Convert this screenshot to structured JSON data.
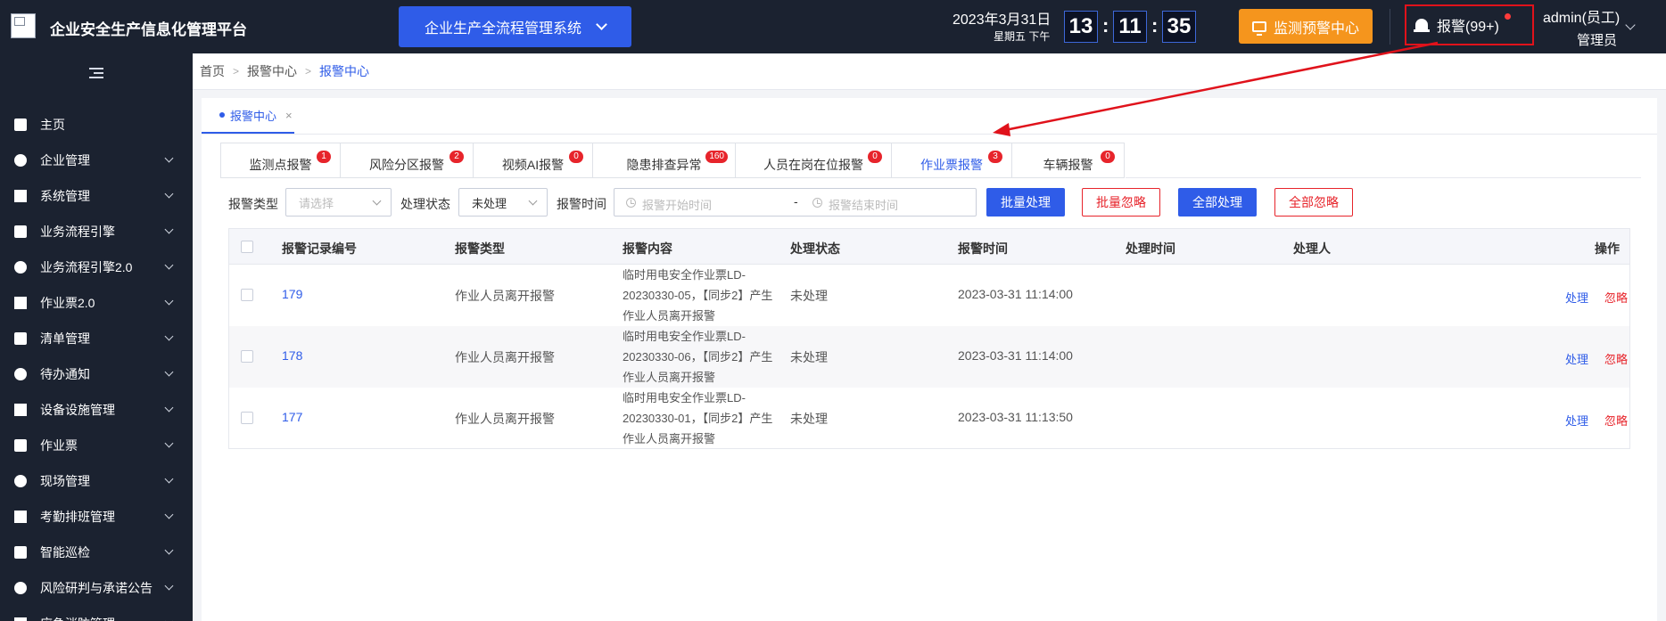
{
  "header": {
    "app_title": "企业安全生产信息化管理平台",
    "system_select": "企业生产全流程管理系统",
    "date": "2023年3月31日",
    "weekday": "星期五  下午",
    "clock": {
      "h": "13",
      "m": "11",
      "s": "35"
    },
    "monitor_button": "监测预警中心",
    "alarm_button": "报警(99+)",
    "user_name": "admin(员工)",
    "user_role": "管理员"
  },
  "sidebar": {
    "items": [
      {
        "label": "主页",
        "icon": "home-icon",
        "has_children": false
      },
      {
        "label": "企业管理",
        "icon": "building-icon",
        "has_children": true
      },
      {
        "label": "系统管理",
        "icon": "gear-icon",
        "has_children": true
      },
      {
        "label": "业务流程引擎",
        "icon": "flow-icon",
        "has_children": true
      },
      {
        "label": "业务流程引擎2.0",
        "icon": "network-icon",
        "has_children": true
      },
      {
        "label": "作业票2.0",
        "icon": "flask-icon",
        "has_children": true
      },
      {
        "label": "清单管理",
        "icon": "list-icon",
        "has_children": true
      },
      {
        "label": "待办通知",
        "icon": "mail-icon",
        "has_children": true
      },
      {
        "label": "设备设施管理",
        "icon": "device-icon",
        "has_children": true
      },
      {
        "label": "作业票",
        "icon": "ticket-icon",
        "has_children": true
      },
      {
        "label": "现场管理",
        "icon": "site-icon",
        "has_children": true
      },
      {
        "label": "考勤排班管理",
        "icon": "bar-chart-icon",
        "has_children": true
      },
      {
        "label": "智能巡检",
        "icon": "grid-icon",
        "has_children": true
      },
      {
        "label": "风险研判与承诺公告",
        "icon": "briefcase-icon",
        "has_children": true
      },
      {
        "label": "应急消防管理",
        "icon": "fire-icon",
        "has_children": true
      }
    ]
  },
  "breadcrumb": {
    "home": "首页",
    "parent": "报警中心",
    "current": "报警中心"
  },
  "page_tab": {
    "label": "报警中心",
    "close": "×"
  },
  "alarm_tabs": [
    {
      "label": "监测点报警",
      "count": "1",
      "active": false
    },
    {
      "label": "风险分区报警",
      "count": "2",
      "active": false
    },
    {
      "label": "视频AI报警",
      "count": "0",
      "active": false
    },
    {
      "label": "隐患排查异常",
      "count": "160",
      "active": false
    },
    {
      "label": "人员在岗在位报警",
      "count": "0",
      "active": false
    },
    {
      "label": "作业票报警",
      "count": "3",
      "active": true
    },
    {
      "label": "车辆报警",
      "count": "0",
      "active": false
    }
  ],
  "filters": {
    "type_label": "报警类型",
    "type_placeholder": "请选择",
    "status_label": "处理状态",
    "status_value": "未处理",
    "time_label": "报警时间",
    "start_placeholder": "报警开始时间",
    "range_sep": "-",
    "end_placeholder": "报警结束时间"
  },
  "actions": {
    "batch_process": "批量处理",
    "batch_ignore": "批量忽略",
    "process_all": "全部处理",
    "ignore_all": "全部忽略"
  },
  "table": {
    "headers": {
      "id": "报警记录编号",
      "type": "报警类型",
      "content": "报警内容",
      "status": "处理状态",
      "time": "报警时间",
      "handle_time": "处理时间",
      "handler": "处理人",
      "op": "操作"
    },
    "rows": [
      {
        "id": "179",
        "type": "作业人员离开报警",
        "content": "临时用电安全作业票LD-20230330-05，【同步2】产生作业人员离开报警",
        "status": "未处理",
        "time": "2023-03-31 11:14:00",
        "handle_time": "",
        "handler": "",
        "process": "处理",
        "ignore": "忽略"
      },
      {
        "id": "178",
        "type": "作业人员离开报警",
        "content": "临时用电安全作业票LD-20230330-06，【同步2】产生作业人员离开报警",
        "status": "未处理",
        "time": "2023-03-31 11:14:00",
        "handle_time": "",
        "handler": "",
        "process": "处理",
        "ignore": "忽略"
      },
      {
        "id": "177",
        "type": "作业人员离开报警",
        "content": "临时用电安全作业票LD-20230330-01，【同步2】产生作业人员离开报警",
        "status": "未处理",
        "time": "2023-03-31 11:13:50",
        "handle_time": "",
        "handler": "",
        "process": "处理",
        "ignore": "忽略"
      }
    ]
  },
  "colors": {
    "header_bg": "#1b2230",
    "primary": "#2f5ce8",
    "warning": "#f5951d",
    "danger": "#e7242b"
  }
}
